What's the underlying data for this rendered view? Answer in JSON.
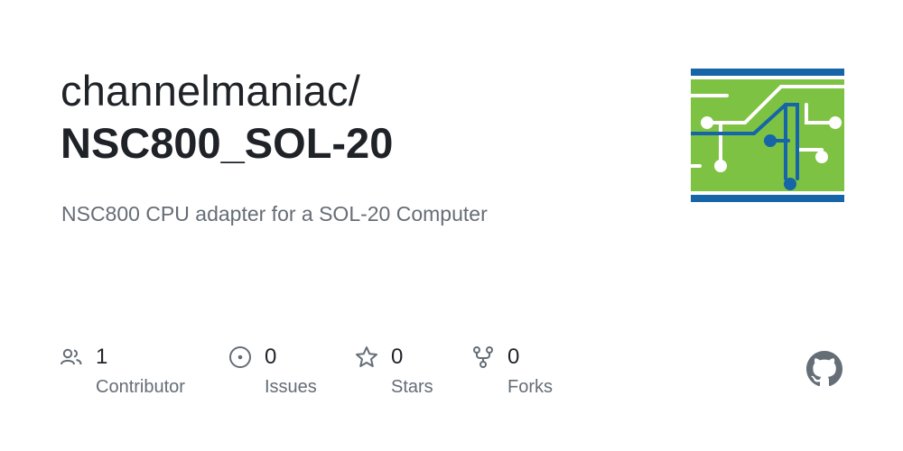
{
  "repo": {
    "owner": "channelmaniac/",
    "name": "NSC800_SOL-20",
    "description": "NSC800 CPU adapter for a SOL-20 Computer"
  },
  "stats": [
    {
      "icon": "people-icon",
      "count": "1",
      "label": "Contributor"
    },
    {
      "icon": "issue-icon",
      "count": "0",
      "label": "Issues"
    },
    {
      "icon": "star-icon",
      "count": "0",
      "label": "Stars"
    },
    {
      "icon": "fork-icon",
      "count": "0",
      "label": "Forks"
    }
  ],
  "colors": {
    "logo_green": "#7dc242",
    "logo_blue": "#1565a8",
    "text_primary": "#1f2328",
    "text_muted": "#656d76"
  }
}
